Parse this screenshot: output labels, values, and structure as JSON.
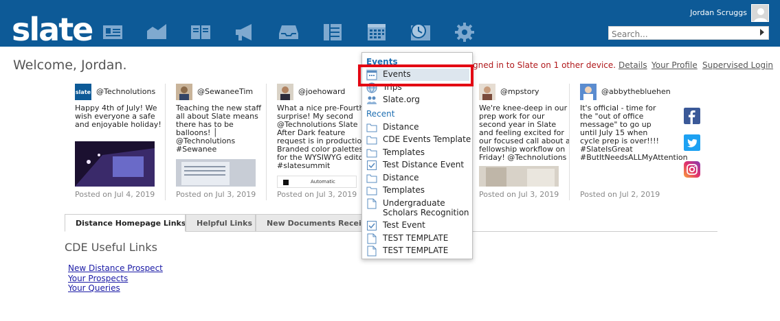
{
  "header": {
    "logo": "slate",
    "nav_icons": [
      "contact-card-icon",
      "analytics-icon",
      "book-icon",
      "megaphone-icon",
      "inbox-icon",
      "queue-list-icon",
      "calendar-icon",
      "clock-icon",
      "gear-icon"
    ],
    "username": "Jordan Scruggs",
    "search_placeholder": "Search...",
    "colors": {
      "bar": "#0d5a97",
      "icon": "#7fa9cf"
    }
  },
  "welcome": {
    "greeting": "Welcome, Jordan.",
    "notice": "gned in to Slate on 1 other device.",
    "links": [
      "Details",
      "Your Profile",
      "Supervised Login"
    ]
  },
  "feed": [
    {
      "handle": "@Technolutions",
      "text": "Happy 4th of July! We wish everyone a safe and enjoyable holiday!",
      "date": "Posted on Jul 4, 2019"
    },
    {
      "handle": "@SewaneeTim",
      "text": "Teaching the new staff all about Slate means there has to be balloons! │ @Technolutions #Sewanee",
      "date": "Posted on Jul 3, 2019"
    },
    {
      "handle": "@joehoward",
      "text": "What a nice pre-Fourth surprise! My second @Technolutions Slate After Dark feature request is in production: Branded color palettes for the WYSIWYG editor. #slatesummit",
      "date": "Posted on Jul 3, 2019",
      "image_text": "Automatic"
    },
    {
      "handle": "@mpstory",
      "text": "We're knee-deep in our prep work for our second year in Slate and feeling excited for our focused call about a fellowship workflow on Friday! @Technolutions",
      "date": "Posted on Jul 3, 2019"
    },
    {
      "handle": "@abbythebluehen",
      "text": "It's official - time for the \"out of office message\" to go up until July 15 when cycle prep is over!!!! #SlateIsGreat #ButItNeedsALLMyAttention",
      "date": "Posted on Jul 2, 2019"
    }
  ],
  "social_icons": [
    "facebook-icon",
    "twitter-icon",
    "instagram-icon"
  ],
  "tabs": [
    "Distance Homepage Links",
    "Helpful Links",
    "New Documents Received"
  ],
  "section": {
    "title": "CDE Useful Links",
    "links": [
      "New Distance Prospect",
      "Your Prospects",
      "Your Queries"
    ]
  },
  "menu": {
    "heading_events": "Events",
    "top_items": [
      {
        "label": "Events",
        "icon": "event-icon"
      },
      {
        "label": "Trips",
        "icon": "globe-icon"
      },
      {
        "label": "Slate.org",
        "icon": "people-icon"
      }
    ],
    "heading_recent": "Recent",
    "recent_items": [
      {
        "label": "Distance",
        "icon": "folder-icon"
      },
      {
        "label": "CDE Events Template",
        "icon": "folder-icon"
      },
      {
        "label": "Templates",
        "icon": "folder-icon"
      },
      {
        "label": "Test Distance Event",
        "icon": "checkbox-icon"
      },
      {
        "label": "Distance",
        "icon": "folder-icon"
      },
      {
        "label": "Templates",
        "icon": "folder-icon"
      },
      {
        "label": "Undergraduate Scholars Recognition",
        "icon": "document-icon"
      },
      {
        "label": "Test Event",
        "icon": "checkbox-icon"
      },
      {
        "label": "TEST TEMPLATE",
        "icon": "document-icon"
      },
      {
        "label": "TEST TEMPLATE",
        "icon": "document-icon"
      }
    ],
    "highlight_color": "#e30613"
  }
}
